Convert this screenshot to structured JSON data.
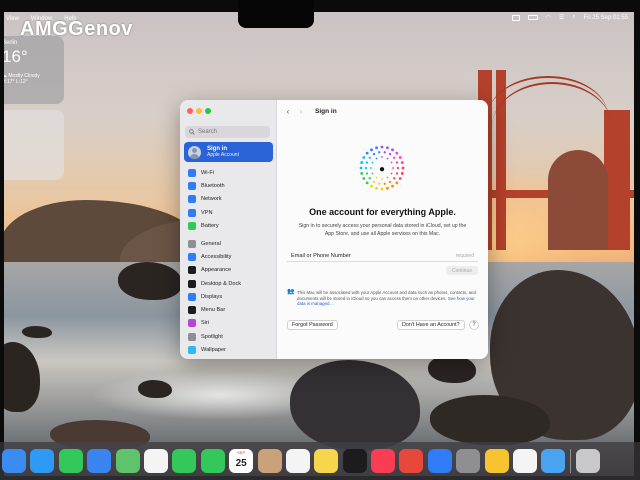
{
  "watermark": "AMGGenov",
  "menubar": {
    "items": [
      "View",
      "Window",
      "Help"
    ],
    "datetime": "Fri 25 Sep  01:55"
  },
  "weather": {
    "city": "Berlin",
    "temp": "16°",
    "condition": "Mostly Cloudy",
    "hilo": "H:17° L:12°"
  },
  "sidebar": {
    "search_placeholder": "Search",
    "account": {
      "name": "Sign in",
      "subtitle": "Apple Account"
    },
    "group1": [
      {
        "label": "Wi-Fi",
        "icon": "wifi-icon",
        "color": "#2f7cf6"
      },
      {
        "label": "Bluetooth",
        "icon": "bluetooth-icon",
        "color": "#2f7cf6"
      },
      {
        "label": "Network",
        "icon": "globe-icon",
        "color": "#2f7cf6"
      },
      {
        "label": "VPN",
        "icon": "vpn-icon",
        "color": "#2f7cf6"
      },
      {
        "label": "Battery",
        "icon": "battery-icon",
        "color": "#34c759"
      }
    ],
    "group2": [
      {
        "label": "General",
        "icon": "gear-icon",
        "color": "#8e8e93"
      },
      {
        "label": "Accessibility",
        "icon": "accessibility-icon",
        "color": "#2f7cf6"
      },
      {
        "label": "Appearance",
        "icon": "appearance-icon",
        "color": "#1c1c1e"
      },
      {
        "label": "Desktop & Dock",
        "icon": "dock-icon",
        "color": "#1c1c1e"
      },
      {
        "label": "Displays",
        "icon": "display-icon",
        "color": "#2f7cf6"
      },
      {
        "label": "Menu Bar",
        "icon": "menubar-icon",
        "color": "#1c1c1e"
      },
      {
        "label": "Siri",
        "icon": "siri-icon",
        "color": "#b04ad6"
      },
      {
        "label": "Spotlight",
        "icon": "spotlight-icon",
        "color": "#8e8e93"
      },
      {
        "label": "Wallpaper",
        "icon": "wallpaper-icon",
        "color": "#2fb8f6"
      }
    ]
  },
  "main": {
    "title": "Sign in",
    "headline": "One account for everything Apple.",
    "subtitle": "Sign in to securely access your personal data stored in iCloud, set up the App Store, and use all Apple services on this Mac.",
    "field_label": "Email or Phone Number",
    "field_hint": "required",
    "continue_label": "Continue",
    "privacy_text": "This Mac will be associated with your Apple Account and data such as photos, contacts, and documents will be stored in iCloud so you can access them on other devices.",
    "privacy_link": "See how your data is managed…",
    "forgot_label": "Forgot Password",
    "create_label": "Don't Have an Account?",
    "help_label": "?"
  },
  "dock": {
    "calendar_month": "SEP",
    "calendar_day": "25",
    "apps": [
      {
        "name": "finder-icon",
        "color": "#3b8cf0"
      },
      {
        "name": "safari-icon",
        "color": "#2f9af4"
      },
      {
        "name": "messages-icon",
        "color": "#34c759"
      },
      {
        "name": "mail-icon",
        "color": "#3a84f0"
      },
      {
        "name": "maps-icon",
        "color": "#5ec36b"
      },
      {
        "name": "photos-icon",
        "color": "#f4f4f4"
      },
      {
        "name": "facetime-icon",
        "color": "#34c759"
      },
      {
        "name": "phone-icon",
        "color": "#34c759"
      },
      {
        "name": "calendar-icon",
        "color": "#ffffff"
      },
      {
        "name": "contacts-icon",
        "color": "#c9a27a"
      },
      {
        "name": "reminders-icon",
        "color": "#f4f4f4"
      },
      {
        "name": "notes-icon",
        "color": "#f6d64a"
      },
      {
        "name": "tv-icon",
        "color": "#1c1c1e"
      },
      {
        "name": "music-icon",
        "color": "#fa3c55"
      },
      {
        "name": "launchpad-icon",
        "color": "#e8473b"
      },
      {
        "name": "app-store-icon",
        "color": "#2f7cf6"
      },
      {
        "name": "system-settings-icon",
        "color": "#8e8e93"
      },
      {
        "name": "tips-icon",
        "color": "#f6c431"
      },
      {
        "name": "preview-icon",
        "color": "#f4f4f4"
      },
      {
        "name": "screen-sharing-icon",
        "color": "#4aa3f0"
      },
      {
        "name": "trash-icon",
        "color": "#c7c7cc"
      }
    ]
  }
}
